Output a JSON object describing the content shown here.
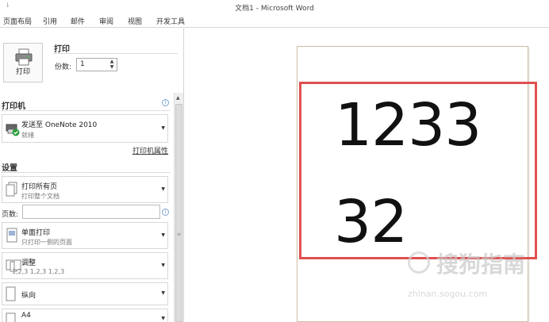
{
  "window": {
    "title": "文档1 - Microsoft Word",
    "quick_access_glyph": "⇂"
  },
  "ribbon": {
    "tabs": [
      "页面布局",
      "引用",
      "邮件",
      "审阅",
      "视图",
      "开发工具"
    ]
  },
  "print": {
    "button_label": "打印",
    "section_title": "打印",
    "copies_label": "份数:",
    "copies_value": "1"
  },
  "printer": {
    "section_title": "打印机",
    "name": "发送至 OneNote 2010",
    "status": "就绪",
    "properties_link": "打印机属性"
  },
  "settings": {
    "section_title": "设置",
    "print_range_main": "打印所有页",
    "print_range_sub": "打印整个文档",
    "pages_label": "页数:",
    "pages_value": "",
    "sides_main": "单面打印",
    "sides_sub": "只打印一侧的页面",
    "collate_main": "调整",
    "collate_sub": "1,2,3    1,2,3    1,2,3",
    "orientation_main": "纵向",
    "paper_main": "A4"
  },
  "preview": {
    "line1": "1233",
    "line2": "32"
  },
  "watermark": {
    "text": "搜狗指南",
    "sub": "zhinan.sogou.com"
  },
  "colors": {
    "highlight": "#e05050",
    "accent": "#4a7ec4",
    "status_check": "#2e9e3e"
  },
  "icons": {
    "print": "printer-icon",
    "info": "info-icon",
    "dropdown": "chevron-down-icon"
  }
}
